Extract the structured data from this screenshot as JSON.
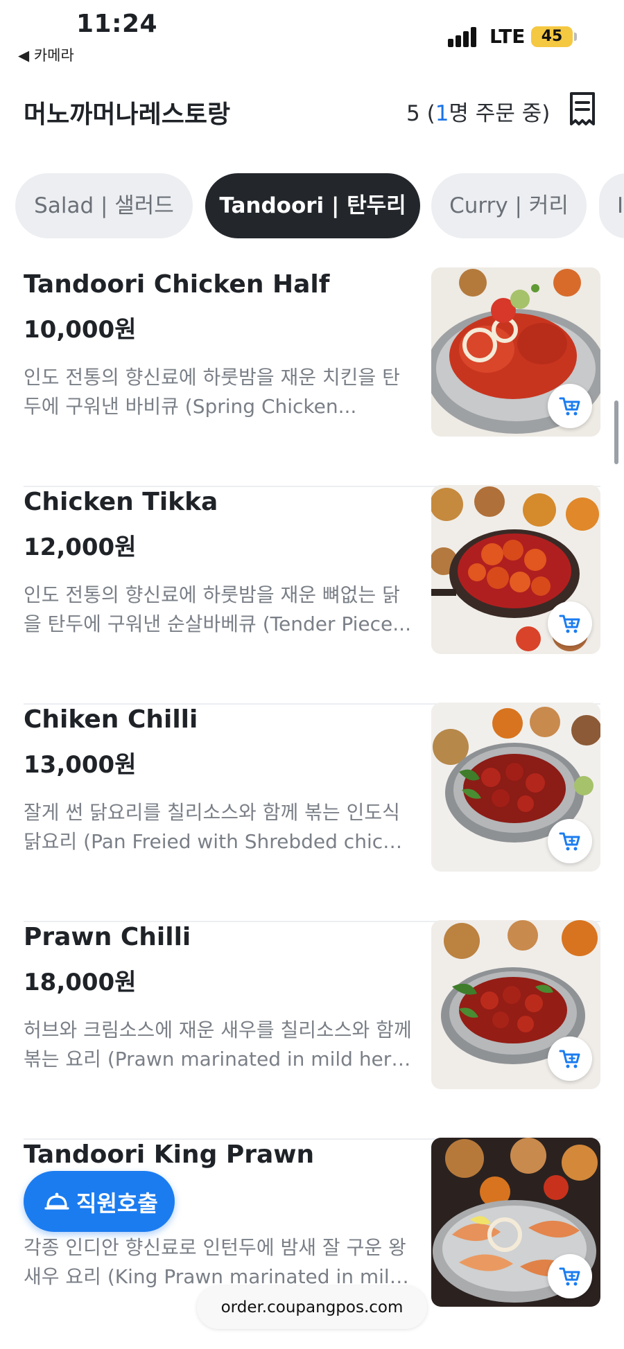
{
  "status_bar": {
    "time": "11:24",
    "back_app": "◀ 카메라",
    "network": "LTE",
    "battery": "45"
  },
  "header": {
    "restaurant_name": "머노까머나레스토랑",
    "order_count": "5",
    "order_open": " (",
    "order_people": "1",
    "order_text": "명 주문 중)"
  },
  "tabs": [
    {
      "label": "Salad | 샐러드",
      "active": false
    },
    {
      "label": "Tandoori | 탄두리",
      "active": true
    },
    {
      "label": "Curry | 커리",
      "active": false
    },
    {
      "label": "I",
      "active": false
    }
  ],
  "menu": [
    {
      "name": "Tandoori Chicken Half",
      "price": "10,000원",
      "desc_line1": "인도 전통의 향신료에 하룻밤을 재운 치킨을 탄",
      "desc_line2": "두에 구워낸 바비큐 (Spring Chicken..."
    },
    {
      "name": "Chicken Tikka",
      "price": "12,000원",
      "desc_line1": "인도 전통의 향신료에 하룻밤을 재운 뼈없는 닭",
      "desc_line2": "을 탄두에 구워낸 순살바베큐 (Tender Piece..."
    },
    {
      "name": "Chiken Chilli",
      "price": "13,000원",
      "desc_line1": "잘게 썬 닭요리를 칠리소스와 함께 볶는 인도식",
      "desc_line2": "닭요리 (Pan Freied with Shrebded chicke..."
    },
    {
      "name": "Prawn Chilli",
      "price": "18,000원",
      "desc_line1": "허브와 크림소스에 재운 새우를 칠리소스와 함께",
      "desc_line2": "볶는 요리 (Prawn marinated in mild herb ..."
    },
    {
      "name": "Tandoori King Prawn",
      "price": "",
      "desc_line1": "각종 인디안 향신료로 인턴두에 밤새 잘 구운 왕",
      "desc_line2": "새우 요리 (King Prawn marinated in mild..."
    }
  ],
  "call_button": {
    "label": "직원호출"
  },
  "url_bar": {
    "url": "order.coupangpos.com"
  },
  "colors": {
    "accent": "#1b7cf0",
    "active_tab": "#23272c",
    "battery": "#f5c842"
  }
}
